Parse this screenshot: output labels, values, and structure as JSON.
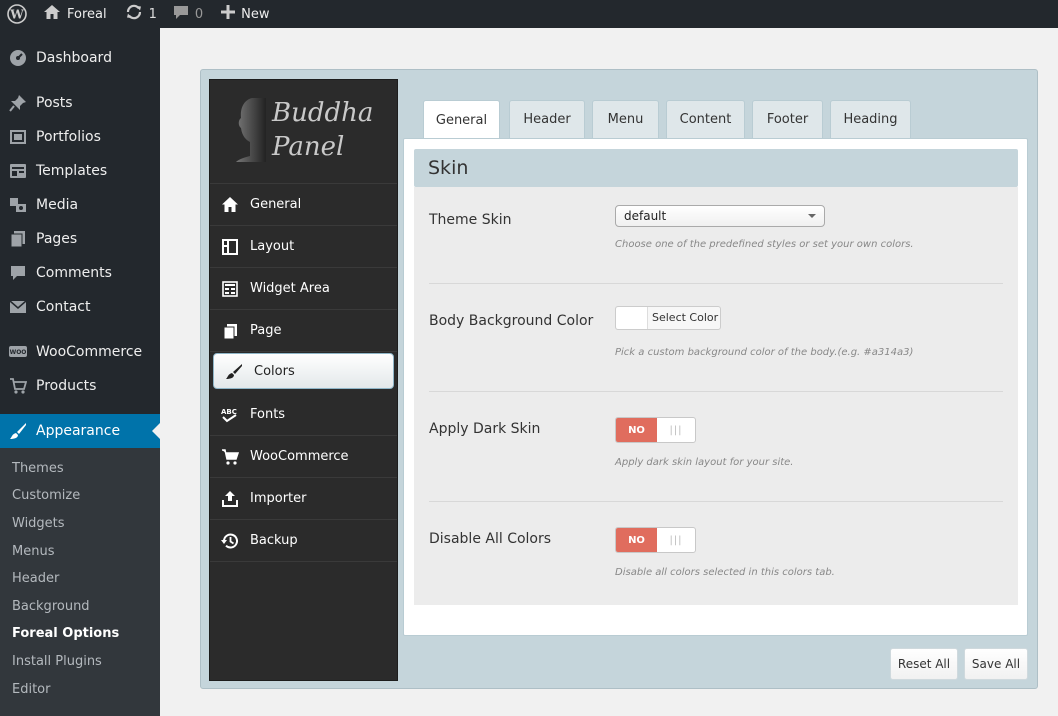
{
  "admin_bar": {
    "site_name": "Foreal",
    "updates_count": "1",
    "comments_count": "0",
    "new_label": "New"
  },
  "admin_menu": {
    "items": [
      {
        "label": "Dashboard",
        "icon": "dashboard-icon"
      },
      {
        "label": "Posts",
        "icon": "pin-icon"
      },
      {
        "label": "Portfolios",
        "icon": "portfolio-icon"
      },
      {
        "label": "Templates",
        "icon": "templates-icon"
      },
      {
        "label": "Media",
        "icon": "media-icon"
      },
      {
        "label": "Pages",
        "icon": "pages-icon"
      },
      {
        "label": "Comments",
        "icon": "comment-icon"
      },
      {
        "label": "Contact",
        "icon": "mail-icon"
      },
      {
        "label": "WooCommerce",
        "icon": "woo-icon"
      },
      {
        "label": "Products",
        "icon": "cart-icon"
      },
      {
        "label": "Appearance",
        "icon": "brush-icon"
      }
    ],
    "submenu": [
      "Themes",
      "Customize",
      "Widgets",
      "Menus",
      "Header",
      "Background",
      "Foreal Options",
      "Install Plugins",
      "Editor"
    ]
  },
  "panel": {
    "logo_line1": "Buddha",
    "logo_line2": "Panel",
    "nav": [
      {
        "label": "General",
        "icon": "home-icon"
      },
      {
        "label": "Layout",
        "icon": "layout-icon"
      },
      {
        "label": "Widget Area",
        "icon": "widget-icon"
      },
      {
        "label": "Page",
        "icon": "page-icon"
      },
      {
        "label": "Colors",
        "icon": "brush-icon"
      },
      {
        "label": "Fonts",
        "icon": "fonts-icon"
      },
      {
        "label": "WooCommerce",
        "icon": "cart-icon"
      },
      {
        "label": "Importer",
        "icon": "upload-icon"
      },
      {
        "label": "Backup",
        "icon": "history-icon"
      }
    ],
    "tabs": [
      "General",
      "Header",
      "Menu",
      "Content",
      "Footer",
      "Heading"
    ],
    "section_title": "Skin",
    "options": {
      "theme_skin": {
        "label": "Theme Skin",
        "value": "default",
        "desc": "Choose one of the predefined styles or set your own colors."
      },
      "body_bg": {
        "label": "Body Background Color",
        "button": "Select Color",
        "desc": "Pick a custom background color of the body.(e.g. #a314a3)"
      },
      "dark_skin": {
        "label": "Apply Dark Skin",
        "state": "NO",
        "desc": "Apply dark skin layout for your site."
      },
      "disable_colors": {
        "label": "Disable All Colors",
        "state": "NO",
        "desc": "Disable all colors selected in this colors tab."
      }
    },
    "reset_label": "Reset All",
    "save_label": "Save All"
  },
  "colors": {
    "admin_dark": "#23282d",
    "accent": "#0073aa",
    "toggle_off": "#e06d5e",
    "panel_bg": "#c5d5db"
  }
}
